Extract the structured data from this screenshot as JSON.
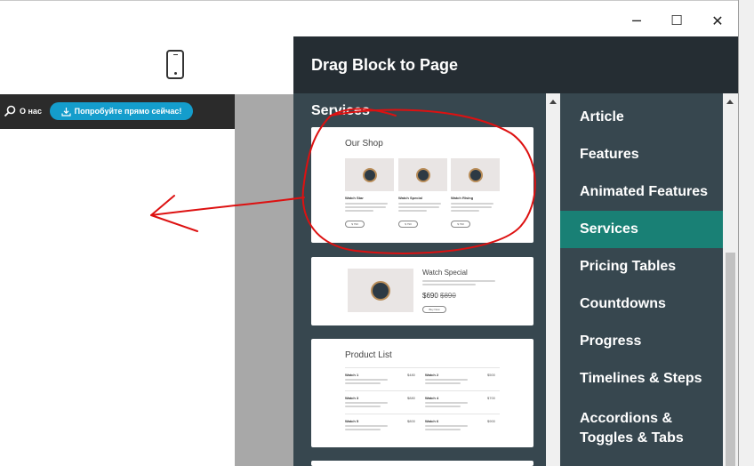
{
  "window": {
    "controls": {
      "minimize": "─",
      "maximize": "☐",
      "close": "✕"
    }
  },
  "page_preview": {
    "nav_about": "О нас",
    "cta_label": "Попробуйте прямо сейчас!",
    "cta_color": "#149dcc"
  },
  "panel": {
    "title": "Drag Block to Page",
    "section_title": "Services",
    "cards": [
      {
        "title": "Our Shop",
        "products": [
          {
            "name": "Watch Star",
            "button": "$ 790"
          },
          {
            "name": "Watch Special",
            "button": "$ 790"
          },
          {
            "name": "Watch Rising",
            "button": "$ 790"
          }
        ]
      },
      {
        "title": "Watch Special",
        "price": "$690",
        "old_price": "$890",
        "button": "Buy Now"
      },
      {
        "title": "Product List",
        "items": [
          {
            "name": "Watch 1",
            "price": "$480"
          },
          {
            "name": "Watch 2",
            "price": "$500"
          },
          {
            "name": "Watch 3",
            "price": "$880"
          },
          {
            "name": "Watch 4",
            "price": "$700"
          },
          {
            "name": "Watch 5",
            "price": "$800"
          },
          {
            "name": "Watch 6",
            "price": "$900"
          }
        ]
      }
    ]
  },
  "categories": {
    "items": [
      "Article",
      "Features",
      "Animated Features",
      "Services",
      "Pricing Tables",
      "Countdowns",
      "Progress",
      "Timelines & Steps",
      "Accordions & Toggles & Tabs"
    ],
    "active": "Services",
    "active_color": "#198075"
  },
  "colors": {
    "panel_header": "#252d33",
    "panel_body": "#37474f",
    "annotation": "#dd1111"
  }
}
